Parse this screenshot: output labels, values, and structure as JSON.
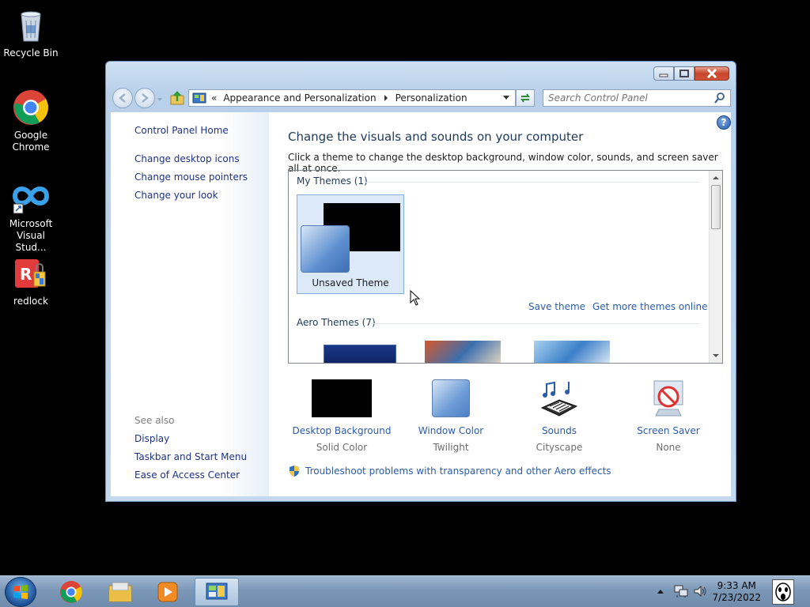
{
  "desktop": {
    "icons": [
      {
        "label": "Recycle Bin"
      },
      {
        "label": "Google Chrome"
      },
      {
        "label": "Microsoft Visual Stud..."
      },
      {
        "label": "redlock"
      }
    ]
  },
  "window": {
    "nav": {
      "address_overflow": "«",
      "breadcrumb": [
        "Appearance and Personalization",
        "Personalization"
      ],
      "search_placeholder": "Search Control Panel"
    },
    "left_pane": {
      "home": "Control Panel Home",
      "links": [
        "Change desktop icons",
        "Change mouse pointers",
        "Change your look"
      ],
      "see_also_header": "See also",
      "see_also": [
        "Display",
        "Taskbar and Start Menu",
        "Ease of Access Center"
      ]
    },
    "main": {
      "title": "Change the visuals and sounds on your computer",
      "subtitle": "Click a theme to change the desktop background, window color, sounds, and screen saver all at once.",
      "my_themes_header": "My Themes (1)",
      "unsaved_theme": "Unsaved Theme",
      "save_theme": "Save theme",
      "get_more": "Get more themes online",
      "aero_themes_header": "Aero Themes (7)",
      "bottom": [
        {
          "name": "Desktop Background",
          "value": "Solid Color"
        },
        {
          "name": "Window Color",
          "value": "Twilight"
        },
        {
          "name": "Sounds",
          "value": "Cityscape"
        },
        {
          "name": "Screen Saver",
          "value": "None"
        }
      ],
      "troubleshoot": "Troubleshoot problems with transparency and other Aero effects"
    },
    "help_glyph": "?"
  },
  "taskbar": {
    "time": "9:33 AM",
    "date": "7/23/2022"
  }
}
